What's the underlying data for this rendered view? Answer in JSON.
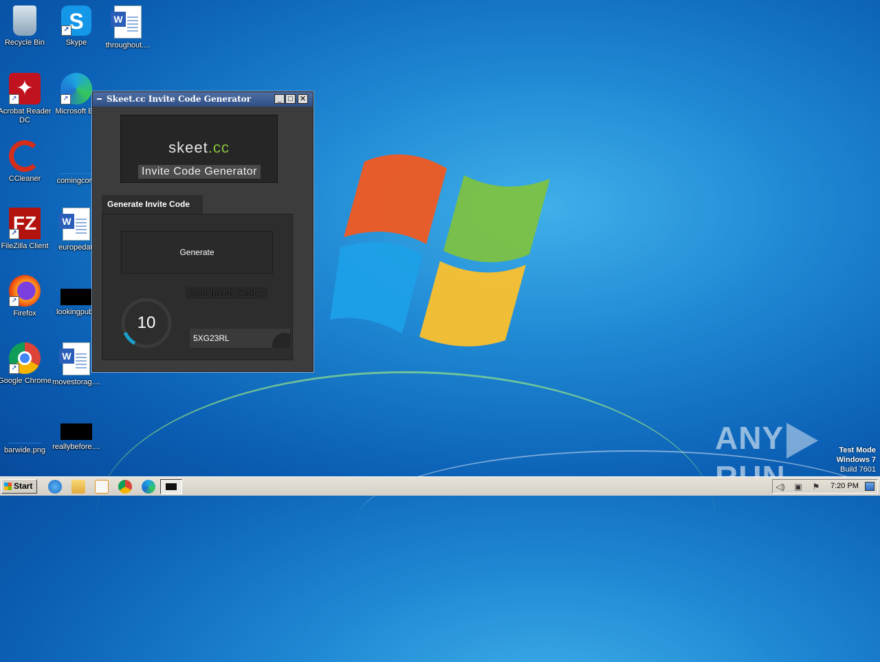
{
  "desktop": {
    "icons": [
      {
        "label": "Recycle Bin"
      },
      {
        "label": "Skype"
      },
      {
        "label": "throughout...."
      },
      {
        "label": "Acrobat Reader DC"
      },
      {
        "label": "Microsoft Ed"
      },
      {
        "label": "CCleaner"
      },
      {
        "label": "comingcorp"
      },
      {
        "label": "FileZilla Client"
      },
      {
        "label": "europedati"
      },
      {
        "label": "Firefox"
      },
      {
        "label": "lookingpubli"
      },
      {
        "label": "Google Chrome"
      },
      {
        "label": "movestorag...."
      },
      {
        "label": "barwide.png"
      },
      {
        "label": "reallybefore...."
      }
    ]
  },
  "window": {
    "title": "Skeet.cc Invite Code Generator",
    "minimize": "_",
    "maximize": "□",
    "close": "✕",
    "logo": {
      "brand": "skeet",
      "tld": ".cc",
      "subtitle": "Invite Code Generator"
    },
    "tab_label": "Generate Invite Code",
    "generate_button": "Generate",
    "code_label": "Your Invite Code :",
    "gauge_value": "10",
    "gauge_fraction": 0.1,
    "invite_code": "5XG23RL",
    "accent_color": "#1aa0c8"
  },
  "watermark": {
    "brand_left": "ANY",
    "brand_right": "RUN"
  },
  "test_mode": {
    "line1": "Test Mode",
    "line2": "Windows 7",
    "line3": "Build 7601"
  },
  "taskbar": {
    "start_label": "Start",
    "clock": "7:20 PM",
    "pinned": [
      "internet-explorer-icon",
      "folder-icon",
      "media-player-icon",
      "chrome-icon",
      "edge-icon",
      "console-window-icon"
    ]
  }
}
